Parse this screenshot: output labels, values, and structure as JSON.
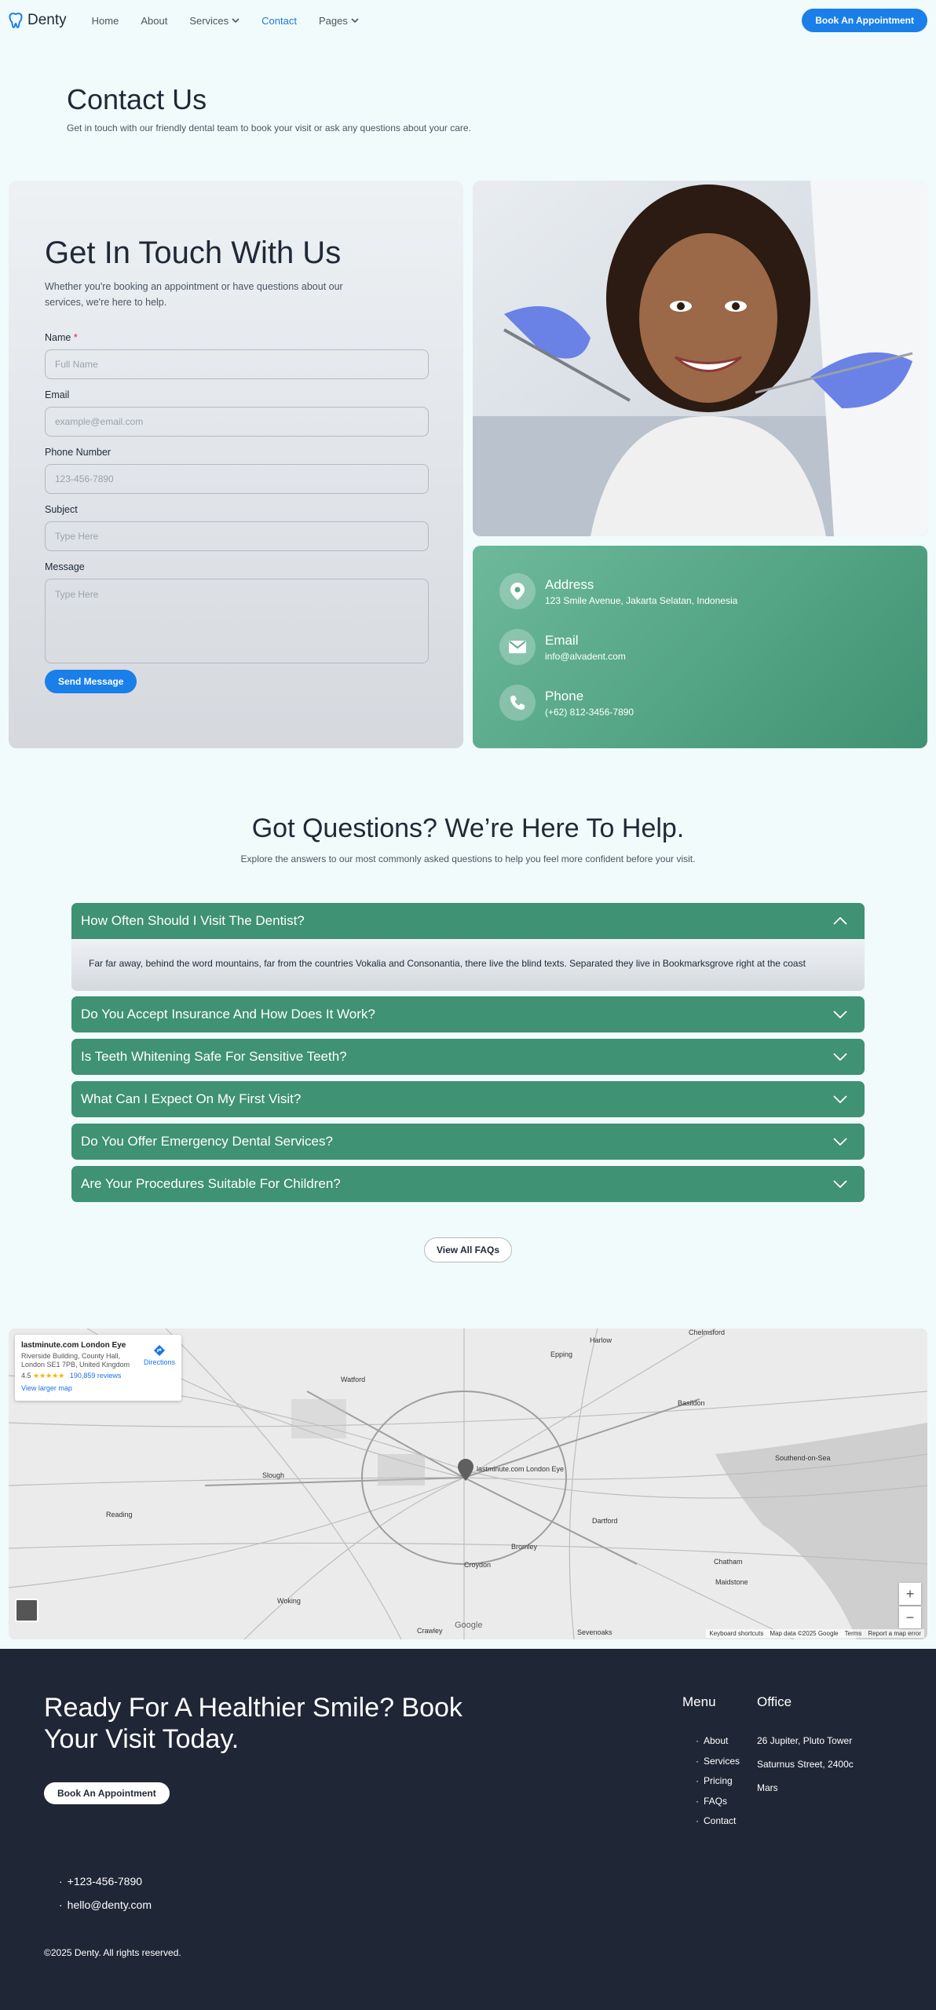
{
  "nav": {
    "logo": "Denty",
    "links": [
      "Home",
      "About",
      "Services",
      "Contact",
      "Pages"
    ],
    "cta": "Book An Appointment"
  },
  "hero": {
    "title": "Contact Us",
    "subtitle": "Get in touch with our friendly dental team to book your visit or ask any questions about your care."
  },
  "form": {
    "title": "Get In Touch With Us",
    "description": "Whether you're booking an appointment or have questions about our services, we're here to help.",
    "fields": [
      {
        "label": "Name",
        "required": "*",
        "placeholder": "Full Name"
      },
      {
        "label": "Email",
        "placeholder": "example@email.com"
      },
      {
        "label": "Phone Number",
        "placeholder": "123-456-7890"
      },
      {
        "label": "Subject",
        "placeholder": "Type Here"
      },
      {
        "label": "Message",
        "placeholder": "Type Here"
      }
    ],
    "submit": "Send Message"
  },
  "contact": {
    "address": {
      "title": "Address",
      "value": "123 Smile Avenue, Jakarta Selatan, Indonesia"
    },
    "email": {
      "title": "Email",
      "value": "info@alvadent.com"
    },
    "phone": {
      "title": "Phone",
      "value": "(+62) 812-3456-7890"
    }
  },
  "faq": {
    "title": "Got Questions? We’re Here To Help.",
    "subtitle": "Explore the answers to our most commonly asked questions to help you feel more confident before your visit.",
    "items": [
      "How Often Should I Visit The Dentist?",
      "Do You Accept Insurance And How Does It Work?",
      "Is Teeth Whitening Safe For Sensitive Teeth?",
      "What Can I Expect On My First Visit?",
      "Do You Offer Emergency Dental Services?",
      "Are Your Procedures Suitable For Children?"
    ],
    "answer": "Far far away, behind the word mountains, far from the countries Vokalia and Consonantia, there live the blind texts. Separated they live in Bookmarksgrove right at the coast",
    "view_all": "View All FAQs"
  },
  "map": {
    "place": "lastminute.com London Eye",
    "address": "Riverside Building, County Hall, London SE1 7PB, United Kingdom",
    "rating": "4.5",
    "stars": "★★★★★",
    "reviews": "190,859 reviews",
    "larger": "View larger map",
    "directions": "Directions",
    "pin_label": "lastminute.com London Eye",
    "footer": [
      "Keyboard shortcuts",
      "Map data ©2025 Google",
      "Terms",
      "Report a map error"
    ],
    "google": "Google",
    "labels": [
      {
        "t": "Watford"
      },
      {
        "t": "Slough"
      },
      {
        "t": "Reading"
      },
      {
        "t": "Woking"
      },
      {
        "t": "Crawley"
      },
      {
        "t": "Dartford"
      },
      {
        "t": "Chelmsford"
      },
      {
        "t": "Basildon"
      },
      {
        "t": "Southend-on-Sea"
      },
      {
        "t": "Maidstone"
      },
      {
        "t": "Sevenoaks"
      },
      {
        "t": "Bromley"
      },
      {
        "t": "Croydon"
      },
      {
        "t": "Epping"
      },
      {
        "t": "Harlow"
      },
      {
        "t": "Chatham"
      }
    ]
  },
  "footer": {
    "heading": "Ready For A Healthier Smile? Book Your Visit Today.",
    "cta": "Book An Appointment",
    "menu_title": "Menu",
    "menu": [
      "About",
      "Services",
      "Pricing",
      "FAQs",
      "Contact"
    ],
    "office_title": "Office",
    "office": [
      "26 Jupiter, Pluto Tower",
      "Saturnus Street, 2400c",
      "Mars"
    ],
    "phone": "+123-456-7890",
    "email": "hello@denty.com",
    "copyright": "©2025 Denty. All rights reserved."
  },
  "colors": {
    "primary": "#1a7fe8",
    "green": "#3f9273",
    "footer": "#1f2736"
  }
}
